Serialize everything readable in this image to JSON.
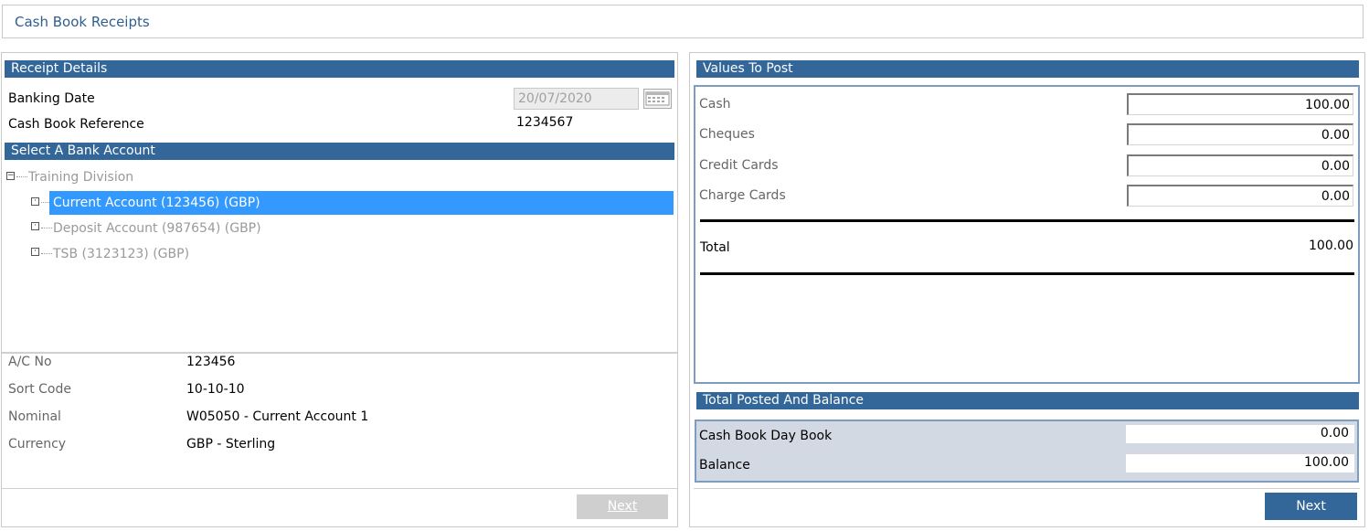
{
  "page": {
    "title": "Cash Book Receipts"
  },
  "receipt_details": {
    "header": "Receipt Details",
    "banking_date_label": "Banking Date",
    "banking_date_value": "20/07/2020",
    "reference_label": "Cash Book Reference",
    "reference_value": "1234567"
  },
  "bank_account": {
    "header": "Select A Bank Account",
    "root": "Training Division",
    "root_toggle": "−",
    "leaf_toggle": "·",
    "items": [
      {
        "label": "Current Account (123456) (GBP)",
        "selected": true
      },
      {
        "label": "Deposit Account (987654) (GBP)",
        "selected": false
      },
      {
        "label": "TSB (3123123) (GBP)",
        "selected": false
      }
    ]
  },
  "account_info": {
    "ac_no_label": "A/C No",
    "ac_no_value": "123456",
    "sort_code_label": "Sort Code",
    "sort_code_value": "10-10-10",
    "nominal_label": "Nominal",
    "nominal_value": "W05050 - Current Account 1",
    "currency_label": "Currency",
    "currency_value": "GBP - Sterling"
  },
  "left_footer": {
    "next_label": "Next"
  },
  "values_to_post": {
    "header": "Values To Post",
    "cash_label": "Cash",
    "cash_value": "100.00",
    "cheques_label": "Cheques",
    "cheques_value": "0.00",
    "credit_cards_label": "Credit Cards",
    "credit_cards_value": "0.00",
    "charge_cards_label": "Charge Cards",
    "charge_cards_value": "0.00",
    "total_label": "Total",
    "total_value": "100.00"
  },
  "total_posted": {
    "header": "Total Posted And Balance",
    "day_book_label": "Cash Book Day Book",
    "day_book_value": "0.00",
    "balance_label": "Balance",
    "balance_value": "100.00"
  },
  "right_footer": {
    "next_label": "Next"
  },
  "colors": {
    "header_bg": "#336699",
    "selection": "#3399ff",
    "title_text": "#2f5f8f",
    "balance_bg": "#d2d9e3"
  }
}
